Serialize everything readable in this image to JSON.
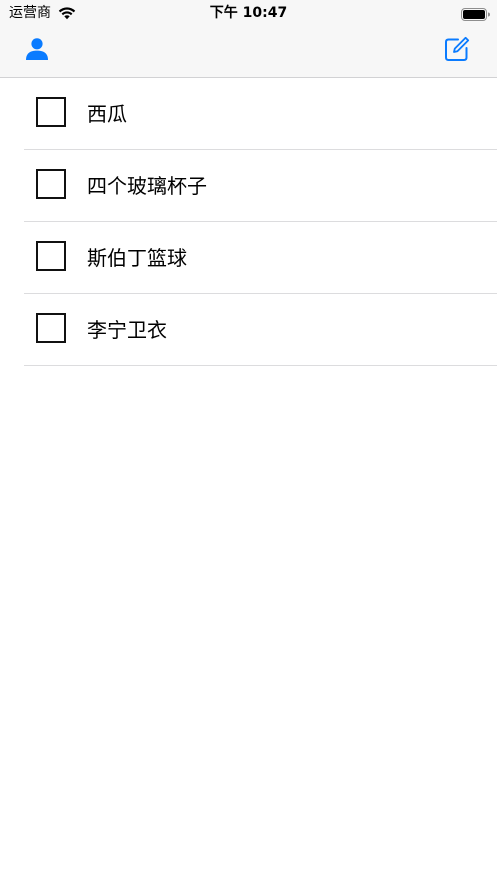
{
  "status_bar": {
    "carrier": "运营商",
    "time": "下午 10:47"
  },
  "nav_bar": {
    "left_icon": "person-icon",
    "right_icon": "compose-icon",
    "accent_color": "#0a7bff"
  },
  "items": [
    {
      "label": "西瓜",
      "checked": false
    },
    {
      "label": "四个玻璃杯子",
      "checked": false
    },
    {
      "label": "斯伯丁篮球",
      "checked": false
    },
    {
      "label": "李宁卫衣",
      "checked": false
    }
  ]
}
